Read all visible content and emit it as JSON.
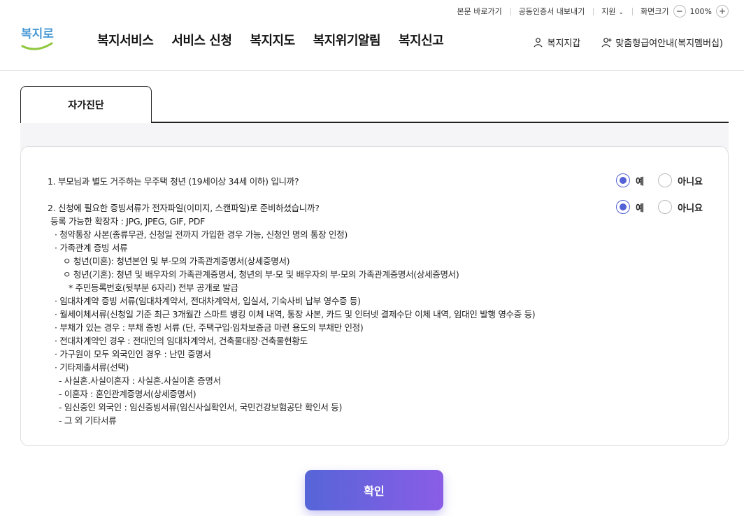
{
  "utility": {
    "skip_link": "본문 바로가기",
    "cert_export": "공동인증서 내보내기",
    "support": "지원",
    "zoom_label": "화면크기",
    "zoom_value": "100%"
  },
  "header": {
    "logo_text": "복지로",
    "gnb": [
      "복지서비스",
      "서비스 신청",
      "복지지도",
      "복지위기알림",
      "복지신고"
    ],
    "wallet": "복지지갑",
    "membership": "맞춤형급여안내(복지멤버십)"
  },
  "tab": {
    "label": "자가진단"
  },
  "questions": [
    {
      "lines": [
        "1. 부모님과 별도 거주하는 무주택 청년 (19세이상 34세 이하) 입니까?"
      ],
      "yes": "예",
      "no": "아니요",
      "selected": "yes"
    },
    {
      "lines": [
        "2. 신청에 필요한 증빙서류가 전자파일(이미지, 스캔파일)로 준비하셨습니까?",
        "등록 가능한 확장자 : JPG, JPEG, GIF, PDF",
        "· 청약통장 사본(종류무관, 신청일 전까지 가입한 경우 가능, 신청인 명의 통장 인정)",
        "· 가족관계 증빙 서류",
        "ㅇ 청년(미혼): 청년본인 및 부·모의 가족관계증명서(상세증명서)",
        "ㅇ 청년(기혼): 청년 및 배우자의 가족관계증명서, 청년의 부·모 및 배우자의 부·모의 가족관계증명서(상세증명서)",
        "* 주민등록번호(뒷부분 6자리) 전부 공개로 발급",
        "· 임대차계약 증빙 서류(임대차계약서, 전대차계약서, 입실서, 기숙사비 납부 영수증 등)",
        "· 월세이체서류(신청일 기준 최근 3개월간 스마트 뱅킹 이체 내역, 통장 사본, 카드 및 인터넷 결제수단 이체 내역, 임대인 발행 영수증 등)",
        "· 부채가 있는 경우 : 부채 증빙 서류 (단, 주택구입·임차보증금 마련 용도의 부채만 인정)",
        "· 전대차계약인 경우 : 전대인의 임대차계약서, 건축물대장·건축물현황도",
        "· 가구원이 모두 외국인인 경우 : 난민 증명서",
        "· 기타제출서류(선택)",
        "- 사실혼.사실이혼자 : 사실혼.사실이혼 증명서",
        "- 이혼자 : 혼인관계증명서(상세증명서)",
        "- 임신중인 외국인 : 임신증빙서류(임신사실확인서, 국민건강보험공단 확인서 등)",
        "- 그 외 기타서류"
      ],
      "yes": "예",
      "no": "아니요",
      "selected": "yes"
    }
  ],
  "confirm_label": "확인",
  "colors": {
    "accent": "#5562d6",
    "button_start": "#5665d8",
    "button_end": "#8a5de6",
    "logo": "#4a9ad6"
  }
}
